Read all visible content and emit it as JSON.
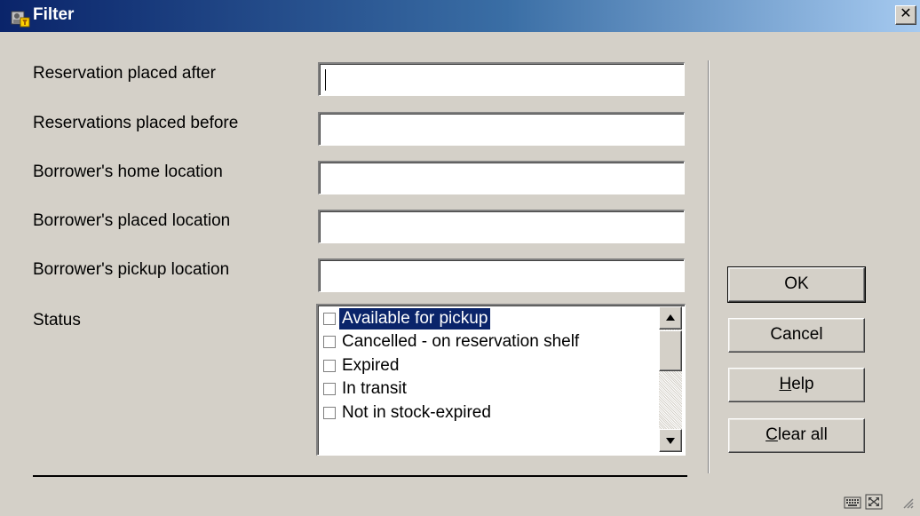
{
  "window": {
    "title": "Filter",
    "close_glyph": "✕",
    "app_icon": "library-filter-icon"
  },
  "form": {
    "fields": [
      {
        "label": "Reservation placed after",
        "value": ""
      },
      {
        "label": "Reservations placed before",
        "value": ""
      },
      {
        "label": "Borrower's home location",
        "value": ""
      },
      {
        "label": "Borrower's placed location",
        "value": ""
      },
      {
        "label": "Borrower's pickup location",
        "value": ""
      }
    ],
    "status_label": "Status",
    "status_options": [
      {
        "label": "Available for pickup",
        "checked": false,
        "selected": true
      },
      {
        "label": "Cancelled - on reservation shelf",
        "checked": false,
        "selected": false
      },
      {
        "label": "Expired",
        "checked": false,
        "selected": false
      },
      {
        "label": "In transit",
        "checked": false,
        "selected": false
      },
      {
        "label": "Not in stock-expired",
        "checked": false,
        "selected": false
      }
    ]
  },
  "buttons": {
    "ok": "OK",
    "cancel": "Cancel",
    "help_accel": "H",
    "help_rest": "elp",
    "clear_accel": "C",
    "clear_rest": "lear all"
  },
  "statusbar": {
    "icons": [
      "keyboard-icon",
      "resize-icon"
    ]
  },
  "colors": {
    "titlebar_start": "#0a246a",
    "titlebar_end": "#a6caf0",
    "dialog_bg": "#d4d0c8",
    "selection": "#0a246a"
  }
}
